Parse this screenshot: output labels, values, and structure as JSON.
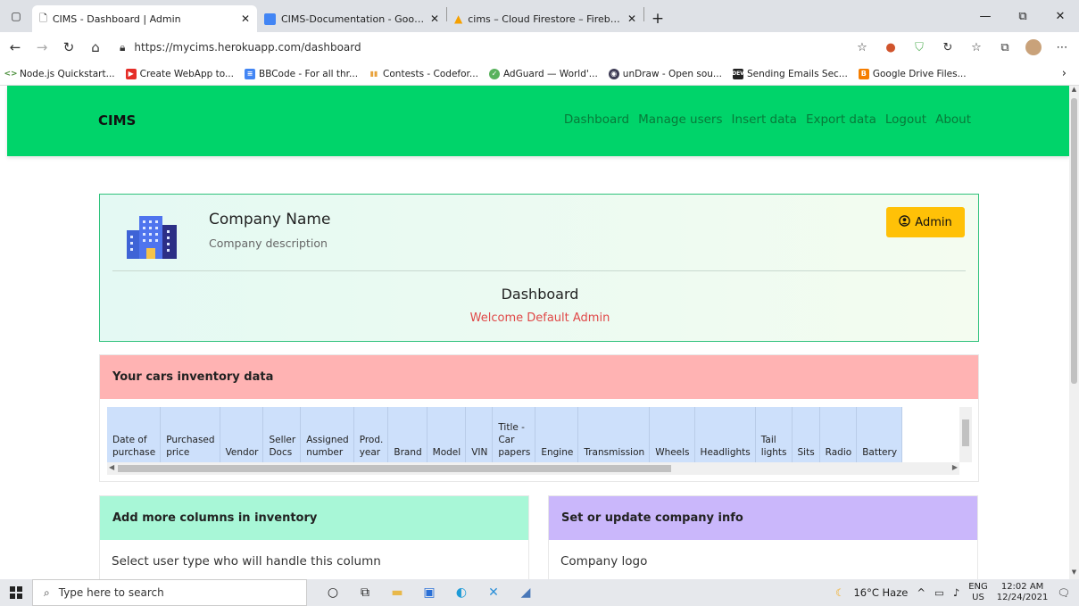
{
  "browser": {
    "tabs": [
      {
        "title": "CIMS - Dashboard | Admin",
        "active": true
      },
      {
        "title": "CIMS-Documentation - Google Docs",
        "active": false
      },
      {
        "title": "cims – Cloud Firestore – Firebase",
        "active": false
      }
    ],
    "new_tab": "+",
    "url": "https://mycims.herokuapp.com/dashboard",
    "bookmarks": [
      "Node.js Quickstart...",
      "Create WebApp to...",
      "BBCode - For all thr...",
      "Contests - Codefor...",
      "AdGuard — World'...",
      "unDraw - Open sou...",
      "Sending Emails Sec...",
      "Google Drive Files..."
    ]
  },
  "site": {
    "brand": "CIMS",
    "nav": [
      "Dashboard",
      "Manage users",
      "Insert data",
      "Export data",
      "Logout",
      "About"
    ]
  },
  "company": {
    "name": "Company Name",
    "description": "Company description",
    "role_button": "Admin",
    "section_title": "Dashboard",
    "welcome": "Welcome Default Admin"
  },
  "inventory": {
    "title": "Your cars inventory data",
    "columns": [
      "Date of\npurchase",
      "Purchased\nprice",
      "Vendor",
      "Seller\nDocs",
      "Assigned\nnumber",
      "Prod.\nyear",
      "Brand",
      "Model",
      "VIN",
      "Title -\nCar\npapers",
      "Engine",
      "Transmission",
      "Wheels",
      "Headlights",
      "Tail\nlights",
      "Sits",
      "Radio",
      "Battery"
    ]
  },
  "add_columns": {
    "title": "Add more columns in inventory",
    "label": "Select user type who will handle this column"
  },
  "company_info": {
    "title": "Set or update company info",
    "label": "Company logo"
  },
  "taskbar": {
    "search_placeholder": "Type here to search",
    "weather": "16°C  Haze",
    "lang_top": "ENG",
    "lang_bottom": "US",
    "time": "12:02 AM",
    "date": "12/24/2021"
  },
  "colors": {
    "navbar": "#00d46a",
    "inventory_header": "#ffb3b3",
    "add_header": "#a8f7d7",
    "info_header": "#cab7fb",
    "admin_button": "#ffc107",
    "welcome_text": "#e04848"
  }
}
